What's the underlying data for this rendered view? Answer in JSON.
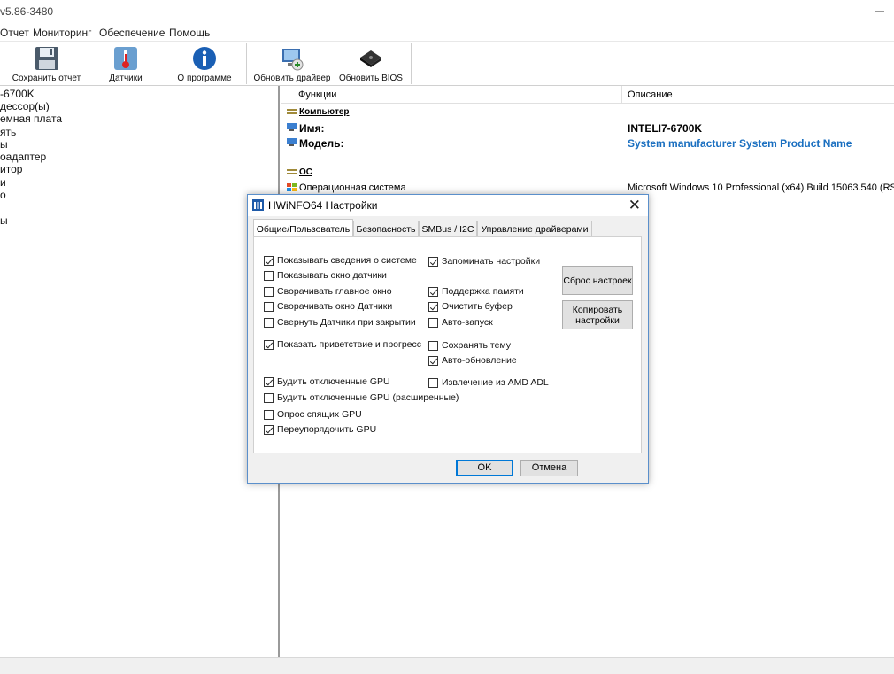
{
  "window": {
    "title": "v5.86-3480"
  },
  "menu": [
    "Отчет",
    "Мониторинг",
    "Обеспечение",
    "Помощь"
  ],
  "toolbar": {
    "save_report": "Сохранить отчет",
    "sensors": "Датчики",
    "about": "О программе",
    "update_driver": "Обновить драйвер",
    "update_bios": "Обновить BIOS"
  },
  "tree": [
    "-6700K",
    "дессор(ы)",
    "емная плата",
    "ять",
    "ы",
    "оадаптер",
    "итор",
    "и",
    "о",
    "ы"
  ],
  "details": {
    "col_function": "Функции",
    "col_description": "Описание",
    "computer_section": "Компьютер",
    "name_label": "Имя:",
    "name_value": "INTELI7-6700K",
    "model_label": "Модель:",
    "model_value": "System manufacturer System Product Name",
    "os_section": "ОС",
    "os_label": "Операционная система",
    "os_value": "Microsoft Windows 10 Professional (x64) Build 15063.540 (RS"
  },
  "dialog": {
    "title": "HWiNFO64 Настройки",
    "tabs": [
      "Общие/Пользователь",
      "Безопасность",
      "SMBus / I2C",
      "Управление драйверами"
    ],
    "left_options": [
      {
        "label": "Показывать сведения о системе",
        "checked": true
      },
      {
        "label": "Показывать окно датчики",
        "checked": false
      },
      {
        "label": "Сворачивать главное окно",
        "checked": false
      },
      {
        "label": "Сворачивать окно Датчики",
        "checked": false
      },
      {
        "label": "Свернуть Датчики при закрытии",
        "checked": false
      },
      {
        "label": "Показать приветствие и прогресс",
        "checked": true
      },
      {
        "label": "Будить отключенные GPU",
        "checked": true
      },
      {
        "label": "Будить отключенные GPU (расширенные)",
        "checked": false
      },
      {
        "label": "Опрос спящих GPU",
        "checked": false
      },
      {
        "label": "Переупорядочить GPU",
        "checked": true
      }
    ],
    "right_options": [
      {
        "label": "Запоминать настройки",
        "checked": true
      },
      {
        "label": "Поддержка памяти",
        "checked": true
      },
      {
        "label": "Очистить буфер",
        "checked": true
      },
      {
        "label": "Авто-запуск",
        "checked": false
      },
      {
        "label": "Сохранять тему",
        "checked": false
      },
      {
        "label": "Авто-обновление",
        "checked": true
      },
      {
        "label": "Извлечение из AMD ADL",
        "checked": false
      }
    ],
    "reset_button": "Сброс настроек",
    "copy_button_line1": "Копировать",
    "copy_button_line2": "настройки",
    "ok": "OK",
    "cancel": "Отмена"
  }
}
